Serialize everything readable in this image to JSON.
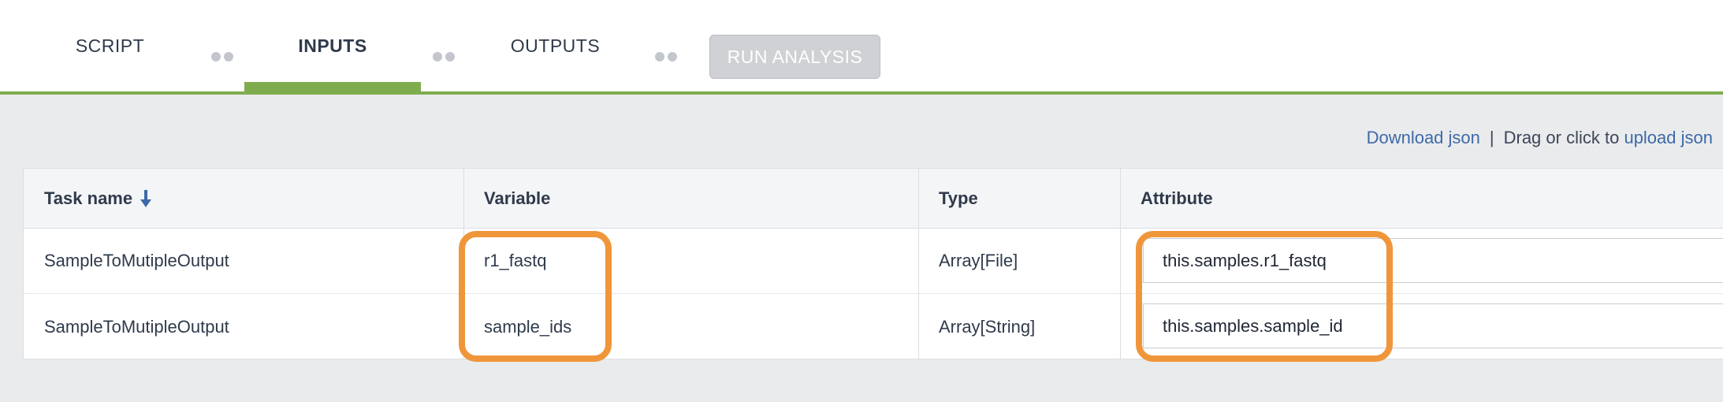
{
  "tabs": {
    "script": "SCRIPT",
    "inputs": "INPUTS",
    "outputs": "OUTPUTS",
    "run_analysis": "RUN ANALYSIS",
    "active": "inputs"
  },
  "json_links": {
    "download": "Download json",
    "separator": "|",
    "drag_text": "Drag or click to",
    "upload": "upload json"
  },
  "table": {
    "headers": {
      "task_name": "Task name",
      "variable": "Variable",
      "type": "Type",
      "attribute": "Attribute"
    },
    "sort_icon": "arrow-down-icon",
    "rows": [
      {
        "task_name": "SampleToMutipleOutput",
        "variable": "r1_fastq",
        "type": "Array[File]",
        "attribute": "this.samples.r1_fastq"
      },
      {
        "task_name": "SampleToMutipleOutput",
        "variable": "sample_ids",
        "type": "Array[String]",
        "attribute": "this.samples.sample_id"
      }
    ]
  },
  "colors": {
    "accent_green": "#7fac4e",
    "highlight_orange": "#f0963a",
    "link_blue": "#3d6aa8",
    "disabled_button": "#cfd1d5"
  }
}
